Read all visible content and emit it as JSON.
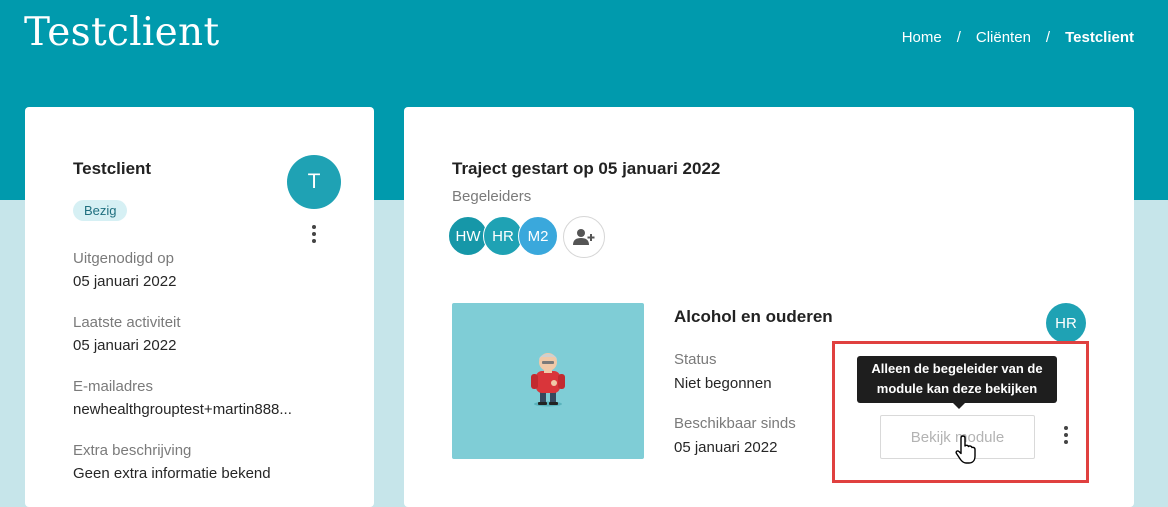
{
  "header": {
    "title": "Testclient",
    "breadcrumb": [
      {
        "label": "Home"
      },
      {
        "label": "Cliënten"
      },
      {
        "label": "Testclient"
      }
    ],
    "separator": "/"
  },
  "client_card": {
    "name": "Testclient",
    "status_badge": "Bezig",
    "avatar_initial": "T",
    "fields": [
      {
        "label": "Uitgenodigd op",
        "value": "05 januari 2022"
      },
      {
        "label": "Laatste activiteit",
        "value": "05 januari 2022"
      },
      {
        "label": "E-mailadres",
        "value": "newhealthgrouptest+martin888..."
      },
      {
        "label": "Extra beschrijving",
        "value": "Geen extra informatie bekend"
      }
    ]
  },
  "traject": {
    "title": "Traject gestart op 05 januari 2022",
    "begeleiders_label": "Begeleiders",
    "begeleiders": [
      {
        "initials": "HW",
        "color": "#1697a8"
      },
      {
        "initials": "HR",
        "color": "#1fa2b4"
      },
      {
        "initials": "M2",
        "color": "#3aa8dc"
      }
    ],
    "add_icon": "add-user-icon"
  },
  "module": {
    "title": "Alcohol en ouderen",
    "status_label": "Status",
    "status_value": "Niet begonnen",
    "available_label": "Beschikbaar sinds",
    "available_value": "05 januari 2022",
    "owner_initials": "HR",
    "view_button": "Bekijk module",
    "tooltip_line1": "Alleen de begeleider van de",
    "tooltip_line2": "module kan deze bekijken"
  },
  "colors": {
    "brand": "#009aad",
    "accent": "#1fa2b4",
    "badge_bg": "#d6f0f4",
    "highlight": "#e0403f"
  }
}
